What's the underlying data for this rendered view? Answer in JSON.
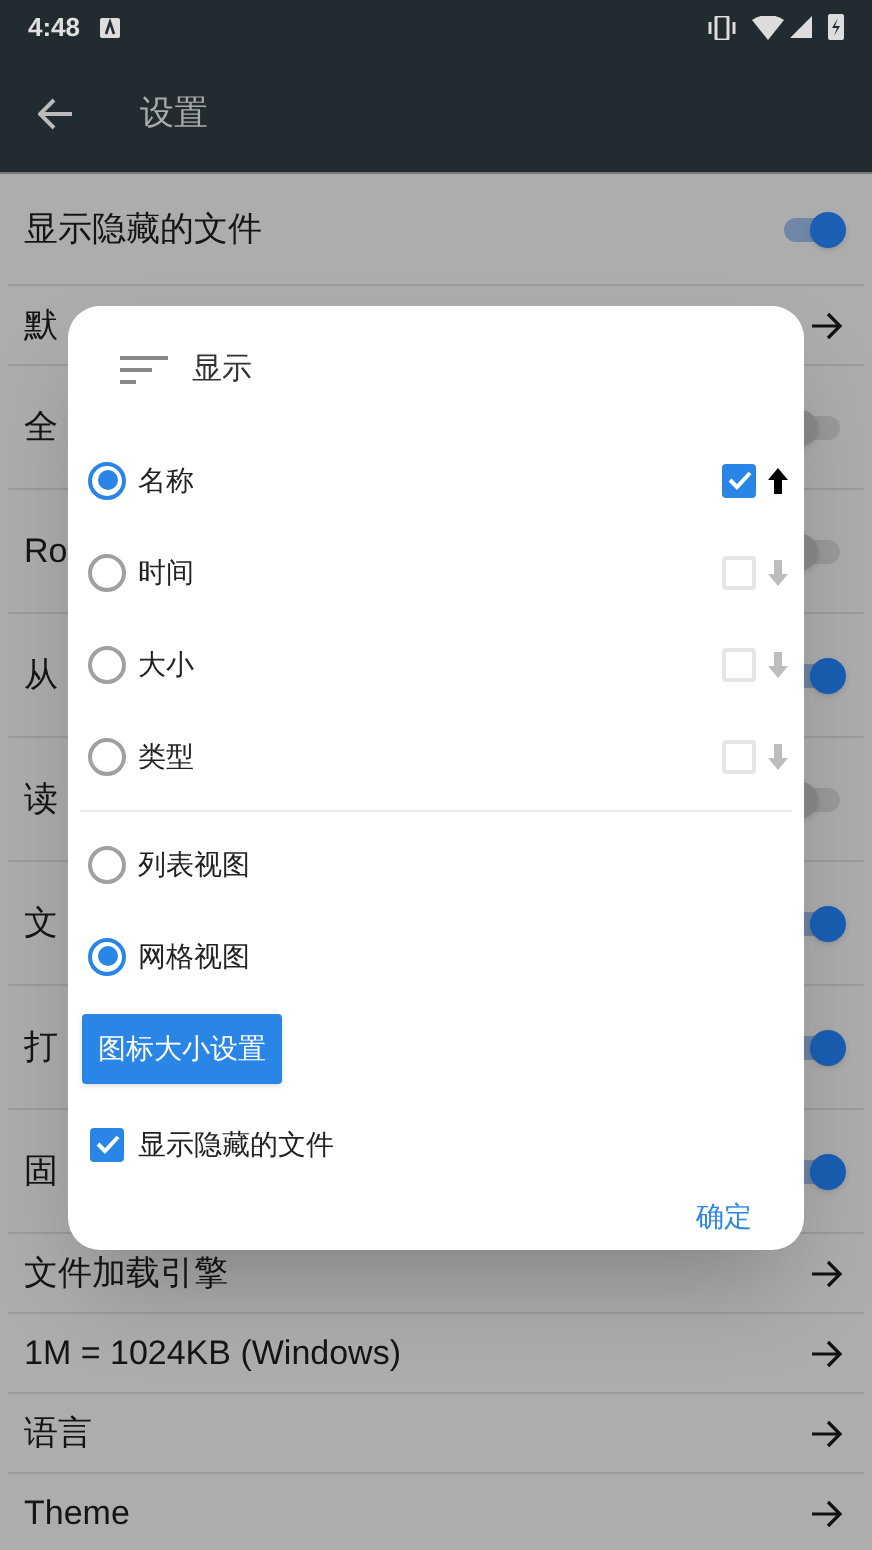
{
  "status_bar": {
    "time": "4:48"
  },
  "app_bar": {
    "title": "设置"
  },
  "settings": [
    {
      "label": "显示隐藏的文件",
      "kind": "toggle",
      "on": true
    },
    {
      "label": "默",
      "kind": "link"
    },
    {
      "label": "全",
      "kind": "toggle",
      "on": false
    },
    {
      "label": "Ro",
      "kind": "toggle",
      "on": false
    },
    {
      "label": "从",
      "kind": "toggle",
      "on": true
    },
    {
      "label": "读",
      "kind": "toggle",
      "on": false
    },
    {
      "label": "文",
      "kind": "toggle",
      "on": true
    },
    {
      "label": "打",
      "kind": "toggle",
      "on": true
    },
    {
      "label": "固",
      "kind": "toggle",
      "on": true
    },
    {
      "label": "文件加载引擎",
      "kind": "link"
    },
    {
      "label": "1M = 1024KB (Windows)",
      "kind": "link"
    },
    {
      "label": "语言",
      "kind": "link"
    },
    {
      "label": "Theme",
      "kind": "link"
    }
  ],
  "dialog": {
    "title": "显示",
    "sort_options": [
      {
        "label": "名称",
        "selected": true,
        "checked": true
      },
      {
        "label": "时间",
        "selected": false,
        "checked": false
      },
      {
        "label": "大小",
        "selected": false,
        "checked": false
      },
      {
        "label": "类型",
        "selected": false,
        "checked": false
      }
    ],
    "view_options": [
      {
        "label": "列表视图",
        "selected": false
      },
      {
        "label": "网格视图",
        "selected": true
      }
    ],
    "icon_size_button": "图标大小设置",
    "show_hidden": {
      "label": "显示隐藏的文件",
      "checked": true
    },
    "ok_button": "确定"
  }
}
